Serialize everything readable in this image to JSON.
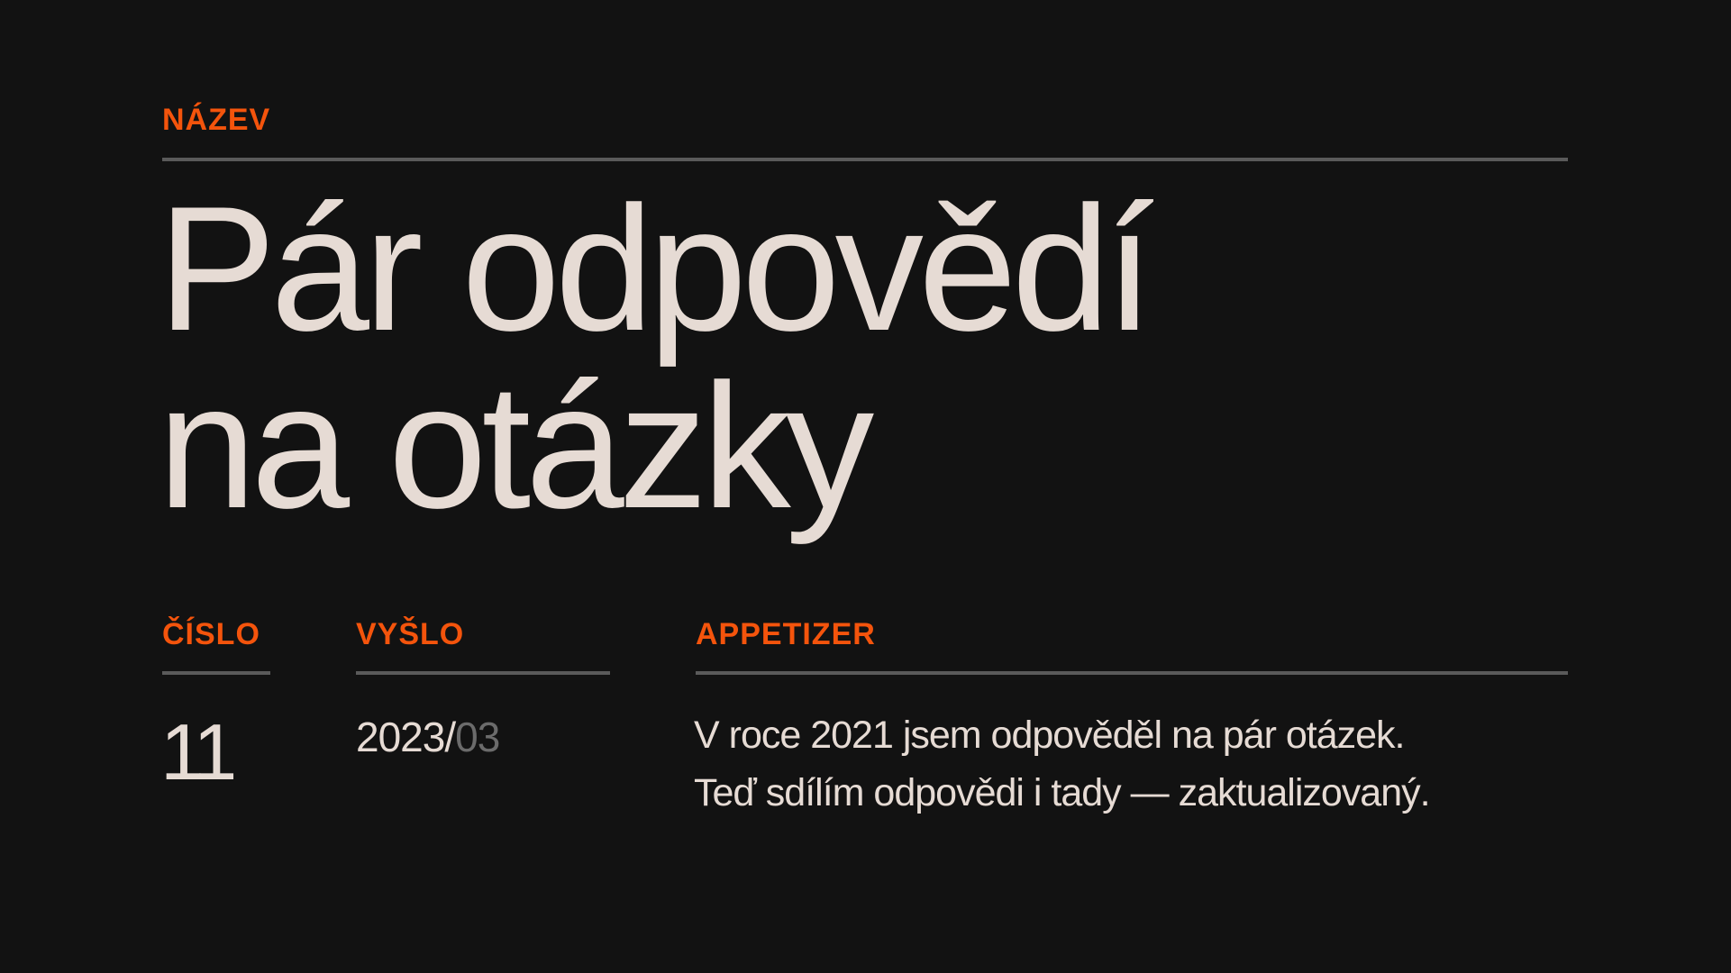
{
  "title_section": {
    "label": "NÁZEV",
    "title_line_1": "Pár odpovědí",
    "title_line_2": "na otázky"
  },
  "issue": {
    "label": "ČÍSLO",
    "value": "11"
  },
  "published": {
    "label": "VYŠLO",
    "year": "2023/",
    "month": "03"
  },
  "appetizer": {
    "label": "APPETIZER",
    "line_1": "V roce 2021 jsem odpověděl na pár otázek.",
    "line_2": "Teď sdílím odpovědi i tady — zaktualizovaný."
  },
  "colors": {
    "background": "#121212",
    "accent": "#f4540c",
    "text": "#e6dbd4",
    "muted": "#6b6b6b",
    "rule": "#5a5a5a"
  }
}
